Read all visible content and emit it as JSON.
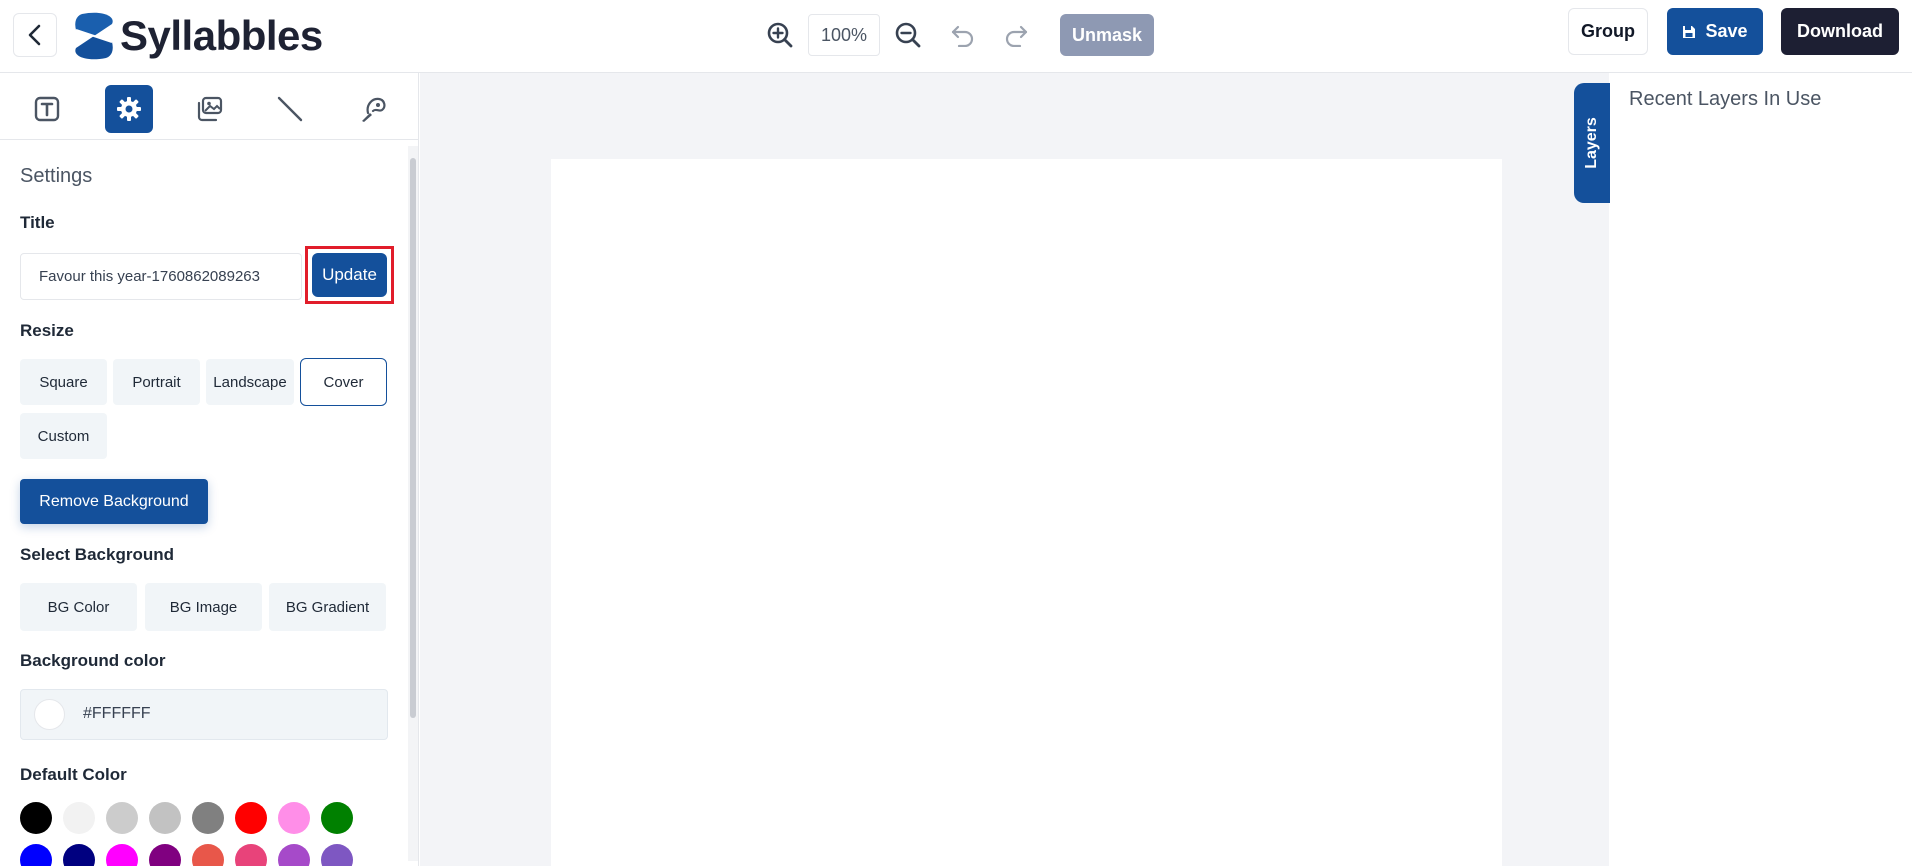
{
  "header": {
    "logo_text": "Syllabbles",
    "zoom_value": "100%",
    "unmask_label": "Unmask",
    "group_label": "Group",
    "save_label": "Save",
    "download_label": "Download",
    "accent_color": "#14509b"
  },
  "tools": [
    {
      "icon": "text-icon"
    },
    {
      "icon": "gear-icon",
      "active": true
    },
    {
      "icon": "images-icon"
    },
    {
      "icon": "line-icon"
    },
    {
      "icon": "brush-icon"
    }
  ],
  "settings": {
    "panel_title": "Settings",
    "title_label": "Title",
    "title_value": "Favour this year-1760862089263",
    "update_label": "Update",
    "resize_label": "Resize",
    "resize_options": [
      "Square",
      "Portrait",
      "Landscape",
      "Cover",
      "Custom"
    ],
    "resize_selected": "Cover",
    "remove_bg_label": "Remove Background",
    "select_bg_label": "Select Background",
    "bg_tabs": [
      "BG Color",
      "BG Image",
      "BG Gradient"
    ],
    "bg_color_label": "Background color",
    "bg_color_value": "#FFFFFF",
    "default_color_label": "Default Color",
    "default_colors_row1": [
      "#000000",
      "#f2f2f2",
      "#cccccc",
      "#c2c2c2",
      "#808080",
      "#ff0000",
      "#ff8ee8",
      "#008000"
    ],
    "default_colors_row2": [
      "#0000ff",
      "#000080",
      "#ff00ff",
      "#800080",
      "#e8574a",
      "#e8437a",
      "#a64ac9",
      "#7e57c2"
    ]
  },
  "layers": {
    "tab_label": "Layers",
    "recent_title": "Recent Layers In Use"
  }
}
